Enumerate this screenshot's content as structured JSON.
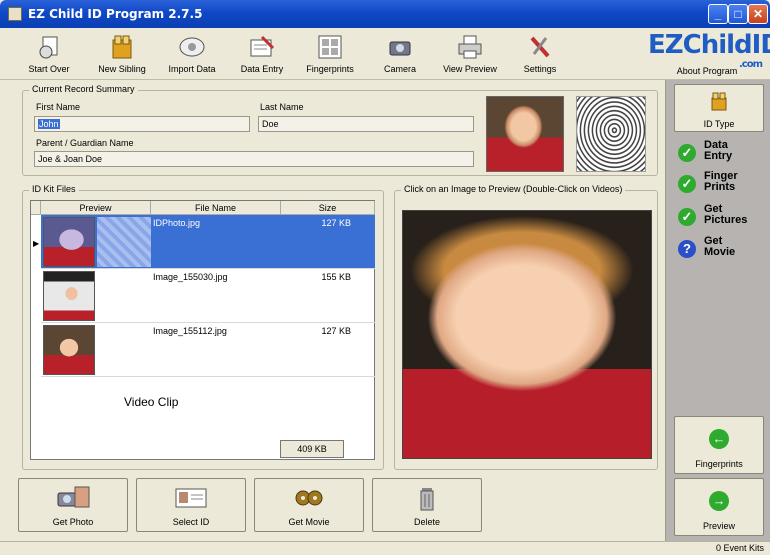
{
  "window": {
    "title": "EZ Child ID Program 2.7.5"
  },
  "toolbar": {
    "items": [
      {
        "label": "Start Over",
        "icon": "start-over-icon"
      },
      {
        "label": "New Sibling",
        "icon": "sibling-icon"
      },
      {
        "label": "Import Data",
        "icon": "import-data-icon"
      },
      {
        "label": "Data Entry",
        "icon": "data-entry-icon"
      },
      {
        "label": "Fingerprints",
        "icon": "fingerprints-icon"
      },
      {
        "label": "Camera",
        "icon": "camera-icon"
      },
      {
        "label": "View Preview",
        "icon": "printer-icon"
      },
      {
        "label": "Settings",
        "icon": "settings-icon"
      }
    ],
    "logo_text": "EZChildID",
    "logo_sub": ".com",
    "about_label": "About Program"
  },
  "record": {
    "legend": "Current Record Summary",
    "first_name_label": "First Name",
    "first_name": "John",
    "last_name_label": "Last Name",
    "last_name": "Doe",
    "guardian_label": "Parent / Guardian Name",
    "guardian": "Joe & Joan Doe"
  },
  "files": {
    "legend": "ID Kit Files",
    "columns": [
      "Preview",
      "File Name",
      "Size"
    ],
    "rows": [
      {
        "file": "IDPhoto.jpg",
        "size": "127 KB",
        "selected": true
      },
      {
        "file": "Image_155030.jpg",
        "size": "155 KB",
        "selected": false
      },
      {
        "file": "Image_155112.jpg",
        "size": "127 KB",
        "selected": false
      }
    ],
    "video_label": "Video Clip",
    "total": "409 KB"
  },
  "preview": {
    "legend": "Click on an Image to Preview (Double-Click on Videos)"
  },
  "sidebar": {
    "id_type_label": "ID Type",
    "steps": [
      {
        "label_1": "Data",
        "label_2": "Entry",
        "status": "done"
      },
      {
        "label_1": "Finger",
        "label_2": "Prints",
        "status": "done"
      },
      {
        "label_1": "Get",
        "label_2": "Pictures",
        "status": "done"
      },
      {
        "label_1": "Get",
        "label_2": "Movie",
        "status": "pending"
      }
    ],
    "fingerprints_label": "Fingerprints",
    "preview_label": "Preview"
  },
  "bottom": {
    "get_photo": "Get Photo",
    "select_id": "Select ID",
    "get_movie": "Get Movie",
    "delete": "Delete"
  },
  "status": {
    "text": "0 Event Kits"
  },
  "colors": {
    "title_bar": "#0f48c8",
    "selection": "#3a6fd4",
    "check_green": "#2eaa2e",
    "pending_blue": "#2a4fc8",
    "sidebar": "#b6b3b0"
  }
}
